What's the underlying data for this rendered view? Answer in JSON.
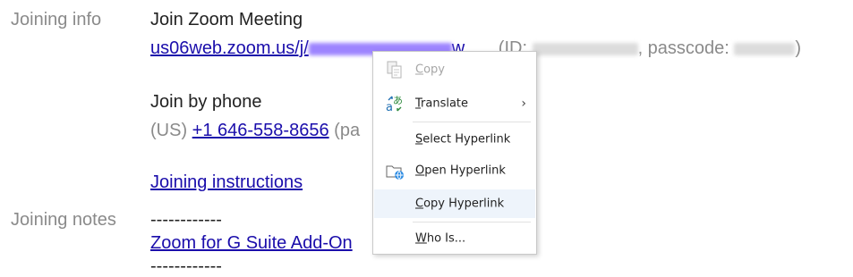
{
  "labels": {
    "joining_info": "Joining info",
    "joining_notes": "Joining notes"
  },
  "joining": {
    "meeting_title": "Join Zoom Meeting",
    "meeting_link": "us06web.zoom.us/j/",
    "meeting_link_tail": "w",
    "id_prefix": "(ID: ",
    "passcode_prefix": ", passcode: ",
    "close_paren": ")",
    "phone_heading": "Join by phone",
    "phone_region": "(US)",
    "phone_number": "+1 646-558-8656",
    "phone_suffix": "(pa",
    "instructions_link": "Joining instructions"
  },
  "notes": {
    "divider_top": "------------",
    "addon_link": "Zoom for G Suite Add-On",
    "divider_bottom": "------------"
  },
  "context_menu": {
    "items": [
      {
        "first": "C",
        "rest": "opy",
        "enabled": false,
        "icon": "copy-icon"
      },
      {
        "first": "T",
        "rest": "ranslate",
        "enabled": true,
        "icon": "translate-icon",
        "submenu": "›"
      },
      {
        "first": "S",
        "rest": "elect Hyperlink",
        "enabled": true
      },
      {
        "first": "O",
        "rest": "pen Hyperlink",
        "enabled": true,
        "icon": "open-hyperlink-icon"
      },
      {
        "first": "C",
        "rest": "opy Hyperlink",
        "enabled": true,
        "highlighted": true
      },
      {
        "first": "W",
        "rest": "ho Is...",
        "enabled": true
      }
    ]
  },
  "colors": {
    "link": "#1a0dab",
    "label": "#8a8a8a",
    "menu_highlight": "#eef4fb"
  }
}
